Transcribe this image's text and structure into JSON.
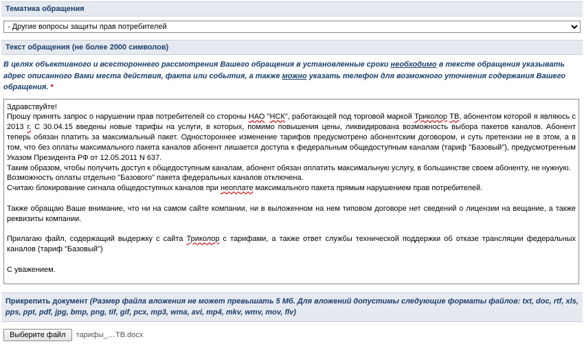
{
  "topic": {
    "header": "Тематика обращения",
    "selected": "- Другие вопросы защиты прав потребителей"
  },
  "body": {
    "header": "Текст обращения (не более 2000 символов)",
    "instruction_parts": {
      "p1": "В целях объективного и всестороннего рассмотрения Вашего обращения в установленные сроки ",
      "u1": "необходимо",
      "p2": " в тексте обращения указывать адрес описанного Вами  места действия, факта или события, а также ",
      "u2": "можно",
      "p3": " указать телефон для возможного уточнения содержания Вашего обращения. ",
      "asterisk": "*"
    },
    "text_html": "Здравствуйте!\nПрошу принять запрос о нарушении прав потребителей со стороны <span class=\"spellerr\">НАО</span> \"<span class=\"spellerr\">НСК</span>\", работающей под торговой маркой <span class=\"spellerr\">Триколор</span> <span class=\"spellerr\">ТВ</span>, абонентом которой я являюсь с 2013 <span class=\"spellerr\">г.</span> С 30.04.15 введены новые тарифы на услуги, в которых, помимо повышения цены, ликвидирована возможность выбора пакетов каналов. Абонент теперь обязан платить за максимальный пакет. Одностороннее изменение тарифов предусмотрено абонентским договором, и суть претензии не в этом, а в том, что без оплаты максимального пакета каналов абонент лишается доступа к федеральным общедоступным каналам (тариф \"Базовый\"), предусмотренным Указом Президента РФ от 12.05.2011 N 637.\nТаким образом, чтобы получить доступ к общедоступным каналам, абонент обязан оплатить максимальную услугу, в большинстве своем абоненту, не нужную.\nВозможность оплаты отдельно \"Базового\" пакета федеральных каналов отключена.\nСчитаю блокирование сигнала общедоступных каналов при <span class=\"spellerr\">неоплате</span> максимального пакета прямым нарушением прав потребителей.\n\nТакже обращаю Ваше внимание, что ни на самом сайте компании, ни в выложенном на нем типовом договоре нет сведений о лицензии на вещание, а также реквизиты компании.\n\nПрилагаю файл, содержащий выдержку с сайта <span class=\"spellerr\">Триколор</span> с тарифами, а также ответ службы технической поддержки об отказе трансляции федеральных каналов (тариф \"Базовый\")\n\nС уважением."
  },
  "attach": {
    "label_bold": "Прикрепить документ ",
    "label_rest": "(Размер файла вложения не может превышать 5 Мб. Для вложений допустимы следующие форматы файлов: txt, doc, rtf, xls, pps, ppt, pdf, jpg, bmp, png, tif, gif, pcx, mp3, wma, avi, mp4, mkv, wmv, mov, flv)",
    "button": "Выберите файл",
    "filename": "тарифы_…ТВ.docx"
  }
}
